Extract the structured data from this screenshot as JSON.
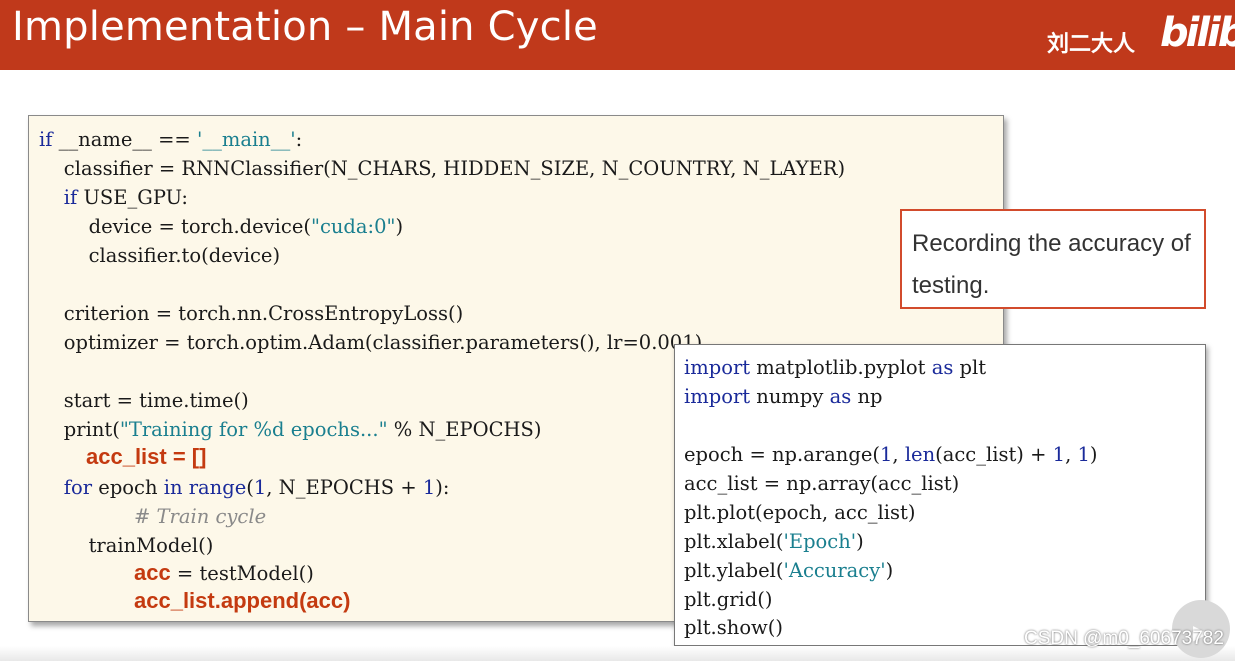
{
  "header": {
    "title": "Implementation – Main Cycle",
    "author": "刘二大人",
    "logo_text": "bilib"
  },
  "main_code": {
    "l1a": "if",
    "l1b": " __name__ == ",
    "l1c": "'__main__'",
    "l1d": ":",
    "l2": "    classifier = RNNClassifier(N_CHARS, HIDDEN_SIZE, N_COUNTRY, N_LAYER)",
    "l3a": "    ",
    "l3b": "if",
    "l3c": " USE_GPU:",
    "l4a": "        device = torch.device(",
    "l4b": "\"cuda:0\"",
    "l4c": ")",
    "l5": "        classifier.to(device)",
    "l7": "    criterion = torch.nn.CrossEntropyLoss()",
    "l8": "    optimizer = torch.optim.Adam(classifier.parameters(), lr=0.001)",
    "l10": "    start = time.time()",
    "l11a": "    print(",
    "l11b": "\"Training for %d epochs...\"",
    "l11c": " % N_EPOCHS)",
    "l12": "acc_list = []",
    "l13a": "    ",
    "l13b": "for",
    "l13c": " epoch ",
    "l13d": "in",
    "l13e": " ",
    "l13f": "range",
    "l13g": "(",
    "l13h": "1",
    "l13i": ", N_EPOCHS + ",
    "l13j": "1",
    "l13k": "):",
    "l14": "# Train cycle",
    "l15": "        trainModel()",
    "l16a": "acc",
    "l16b": " = testModel()",
    "l17": "acc_list.append(acc)"
  },
  "float_code": {
    "f1a": "import",
    "f1b": " matplotlib.pyplot ",
    "f1c": "as",
    "f1d": " plt",
    "f2a": "import",
    "f2b": " numpy ",
    "f2c": "as",
    "f2d": " np",
    "f4a": "epoch = np.arange(",
    "f4b": "1",
    "f4c": ", ",
    "f4d": "len",
    "f4e": "(acc_list) + ",
    "f4f": "1",
    "f4g": ", ",
    "f4h": "1",
    "f4i": ")",
    "f5": "acc_list = np.array(acc_list)",
    "f6": "plt.plot(epoch, acc_list)",
    "f7a": "plt.xlabel(",
    "f7b": "'Epoch'",
    "f7c": ")",
    "f8a": "plt.ylabel(",
    "f8b": "'Accuracy'",
    "f8c": ")",
    "f9": "plt.grid()",
    "f10": "plt.show()"
  },
  "callout": {
    "text": "Recording the accuracy of testing."
  },
  "footer": {
    "watermark": "CSDN @m0_60673782"
  },
  "colors": {
    "header_bg": "#c0391b",
    "keyword": "#1a2a9a",
    "string": "#1a7f8f",
    "highlight": "#c43a10",
    "code_bg": "#fdf8e9"
  }
}
